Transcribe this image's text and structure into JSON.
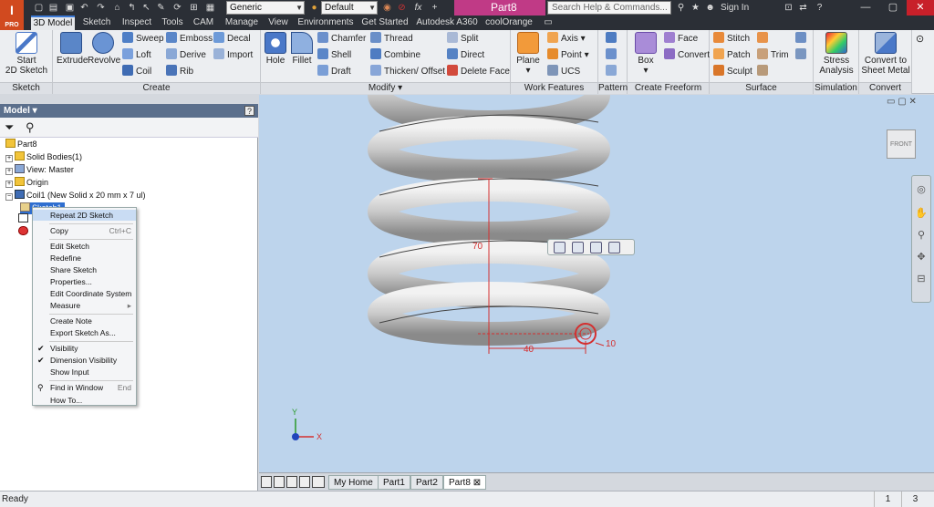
{
  "app": {
    "logo": "I",
    "logo_sub": "PRO",
    "document_title": "Part8"
  },
  "quick_access": {
    "material": "Generic",
    "appearance": "Default",
    "fx": "fx"
  },
  "help": {
    "search_placeholder": "Search Help & Commands...",
    "sign_in": "Sign In"
  },
  "tabs": [
    "3D Model",
    "Sketch",
    "Inspect",
    "Tools",
    "CAM",
    "Manage",
    "View",
    "Environments",
    "Get Started",
    "Autodesk A360",
    "coolOrange"
  ],
  "ribbon": {
    "sketch": {
      "label": "Sketch",
      "start_line1": "Start",
      "start_line2": "2D Sketch"
    },
    "create": {
      "label": "Create",
      "extrude": "Extrude",
      "revolve": "Revolve",
      "sweep": "Sweep",
      "loft": "Loft",
      "coil": "Coil",
      "emboss": "Emboss",
      "derive": "Derive",
      "rib": "Rib",
      "decal": "Decal",
      "import": "Import"
    },
    "modify": {
      "label": "Modify",
      "hole": "Hole",
      "fillet": "Fillet",
      "chamfer": "Chamfer",
      "shell": "Shell",
      "draft": "Draft",
      "thread": "Thread",
      "combine": "Combine",
      "thicken": "Thicken/ Offset",
      "split": "Split",
      "direct": "Direct",
      "delete_face": "Delete Face"
    },
    "work_features": {
      "label": "Work Features",
      "plane": "Plane",
      "axis": "Axis",
      "point": "Point",
      "ucs": "UCS"
    },
    "pattern": {
      "label": "Pattern"
    },
    "create_freeform": {
      "label": "Create Freeform",
      "box": "Box",
      "face": "Face",
      "convert": "Convert"
    },
    "surface": {
      "label": "Surface",
      "stitch": "Stitch",
      "patch": "Patch",
      "sculpt": "Sculpt",
      "trim": "Trim"
    },
    "simulation": {
      "label": "Simulation",
      "stress_line1": "Stress",
      "stress_line2": "Analysis"
    },
    "convert": {
      "label": "Convert",
      "sheet_line1": "Convert to",
      "sheet_line2": "Sheet Metal"
    }
  },
  "browser": {
    "header": "Model",
    "help": "?",
    "tree": {
      "part": "Part8",
      "solid_bodies": "Solid Bodies(1)",
      "view": "View: Master",
      "origin": "Origin",
      "coil": "Coil1 (New Solid x 20 mm x 7 ul)",
      "sketch": "Sketch1"
    }
  },
  "context_menu": {
    "repeat": "Repeat 2D Sketch",
    "copy": "Copy",
    "copy_shortcut": "Ctrl+C",
    "edit_sketch": "Edit Sketch",
    "redefine": "Redefine",
    "share_sketch": "Share Sketch",
    "properties": "Properties...",
    "edit_coord": "Edit Coordinate System",
    "measure": "Measure",
    "create_note": "Create Note",
    "export_sketch": "Export Sketch As...",
    "visibility": "Visibility",
    "dimension_visibility": "Dimension Visibility",
    "show_input": "Show Input",
    "find_in_window": "Find in Window",
    "find_shortcut": "End",
    "how_to": "How To..."
  },
  "viewport": {
    "viewcube_label": "FRONT",
    "dim_height": "70",
    "dim_width": "40",
    "dim_radius": "10",
    "axis_x": "X",
    "axis_y": "Y"
  },
  "doc_tabs": [
    "My Home",
    "Part1",
    "Part2",
    "Part8"
  ],
  "status": {
    "text": "Ready",
    "num1": "1",
    "num2": "3"
  }
}
